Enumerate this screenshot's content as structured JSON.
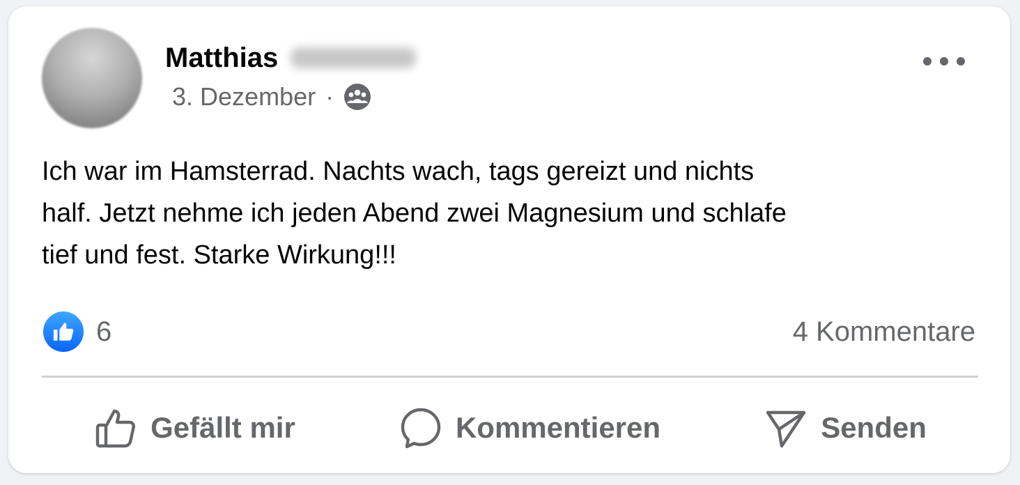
{
  "post": {
    "author_first_name": "Matthias",
    "date": "3. Dezember",
    "separator": "·",
    "audience_icon": "group-audience-icon",
    "text": "Ich war im Hamsterrad. Nachts wach, tags gereizt und nichts\nhalf. Jetzt nehme ich jeden Abend zwei Magnesium und schlafe\ntief und fest. Starke Wirkung!!!",
    "like_count": "6",
    "comments_label": "4 Kommentare"
  },
  "actions": {
    "like_label": "Gefällt mir",
    "comment_label": "Kommentieren",
    "send_label": "Senden"
  },
  "colors": {
    "like_blue": "#0866ff",
    "secondary_text": "#65676b",
    "primary_text": "#050505"
  }
}
